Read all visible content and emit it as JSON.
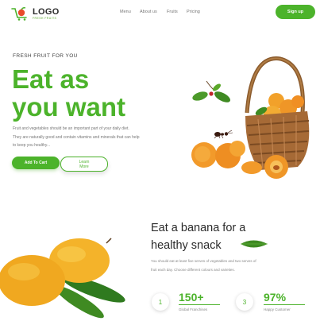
{
  "header": {
    "logo_text": "LOGO",
    "logo_sub": "FRESH FRUITS",
    "nav": [
      "Menu",
      "About us",
      "Fruits",
      "Pricing"
    ],
    "signup_label": "Sign up"
  },
  "hero": {
    "kicker": "FRESH FRUIT FOR YOU",
    "title_line1": "Eat as",
    "title_line2": "you want",
    "paragraph_lines": [
      "Fruit and vegetables should be an important part of your daily diet.",
      "They are naturally good and contain vitamins and minerals that can help",
      "to keep you healthy..."
    ],
    "cart_label": "Add To Cart",
    "learn_line1": "Learn",
    "learn_line2": "More"
  },
  "section2": {
    "title_line1": "Eat a banana for a",
    "title_line2": "healthy snack",
    "paragraph_lines": [
      "You should eat at least five serves of vegetables and two serves of",
      "fruit each day. Choose different colours and varieties."
    ],
    "stats": [
      {
        "index": "1",
        "value": "150+",
        "label": "Global Franchises"
      },
      {
        "index": "3",
        "value": "97%",
        "label": "Happy Customer"
      }
    ]
  },
  "colors": {
    "brand": "#4cb32b",
    "text": "#2b2b2b",
    "muted": "#888888"
  }
}
